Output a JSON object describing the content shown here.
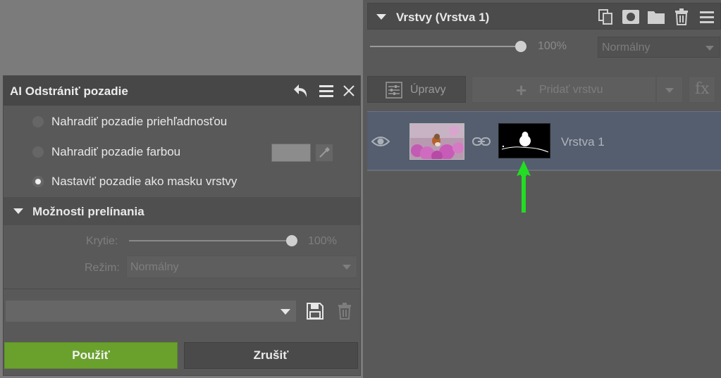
{
  "layers_panel": {
    "title": "Vrstvy (Vrstva 1)",
    "opacity_value": "100%",
    "opacity_level": 1.0,
    "blend_mode": "Normálny",
    "adjust_button": "Úpravy",
    "add_layer_button": "Pridať vrstvu",
    "fx_button": "fx",
    "layers": [
      {
        "name": "Vrstva 1",
        "visible": true
      }
    ]
  },
  "dialog": {
    "title": "AI Odstrániť pozadie",
    "options": [
      {
        "label": "Nahradiť pozadie priehľadnosťou",
        "selected": false
      },
      {
        "label": "Nahradiť pozadie farbou",
        "selected": false
      },
      {
        "label": "Nastaviť pozadie ako masku vrstvy",
        "selected": true
      }
    ],
    "replace_color": "#8c8c8c",
    "blending_section": {
      "title": "Možnosti prelínania",
      "opacity_label": "Krytie:",
      "opacity_value": "100%",
      "opacity_level": 1.0,
      "mode_label": "Režim:",
      "mode_value": "Normálny"
    },
    "preset_value": "",
    "apply_button": "Použiť",
    "cancel_button": "Zrušiť"
  },
  "colors": {
    "apply_green": "#6aa12d",
    "selected_layer_bg": "#545e6e",
    "annotation_arrow": "#22dd22"
  }
}
